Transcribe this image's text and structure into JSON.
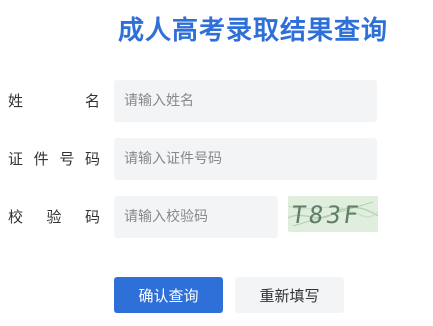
{
  "title": "成人高考录取结果查询",
  "form": {
    "name_label": [
      "姓",
      "名"
    ],
    "name_placeholder": "请输入姓名",
    "id_label": [
      "证",
      "件",
      "号",
      "码"
    ],
    "id_placeholder": "请输入证件号码",
    "code_label": [
      "校",
      "验",
      "码"
    ],
    "code_placeholder": "请输入校验码",
    "captcha_text": "T83F"
  },
  "buttons": {
    "submit": "确认查询",
    "reset": "重新填写"
  },
  "colors": {
    "accent": "#2f6fd8",
    "input_bg": "#f3f4f6",
    "captcha_bg": "#dfeedd"
  }
}
